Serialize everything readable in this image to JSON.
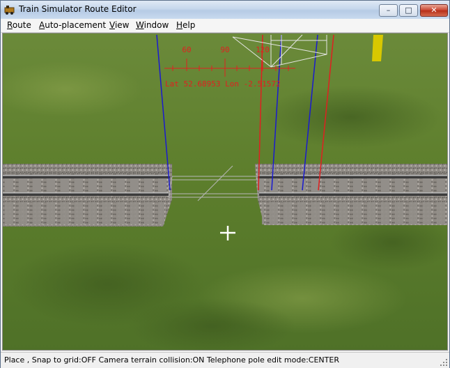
{
  "window": {
    "title": "Train Simulator Route Editor",
    "controls": {
      "minimize": "–",
      "maximize": "□",
      "close": "✕"
    }
  },
  "menu": [
    {
      "label": "Route",
      "underline": "R",
      "rest": "oute"
    },
    {
      "label": "Auto-placement",
      "underline": "A",
      "rest": "uto-placement"
    },
    {
      "label": "View",
      "underline": "V",
      "rest": "iew"
    },
    {
      "label": "Window",
      "underline": "W",
      "rest": "indow"
    },
    {
      "label": "Help",
      "underline": "H",
      "rest": "elp"
    }
  ],
  "hud": {
    "heading_ticks": [
      "60",
      "90",
      "120"
    ],
    "coordinates": "Lat 52.68953 Lon -2.51572"
  },
  "status": {
    "text": "Place , Snap to grid:OFF Camera terrain collision:ON Telephone pole edit mode:CENTER"
  },
  "colors": {
    "grass": "#5b7a2e",
    "ballast": "#8a8580",
    "rail": "#3a3a3a",
    "hud_red": "#e02020",
    "pole_blue": "#1a1ad0",
    "marker_yellow": "#d8c800"
  }
}
